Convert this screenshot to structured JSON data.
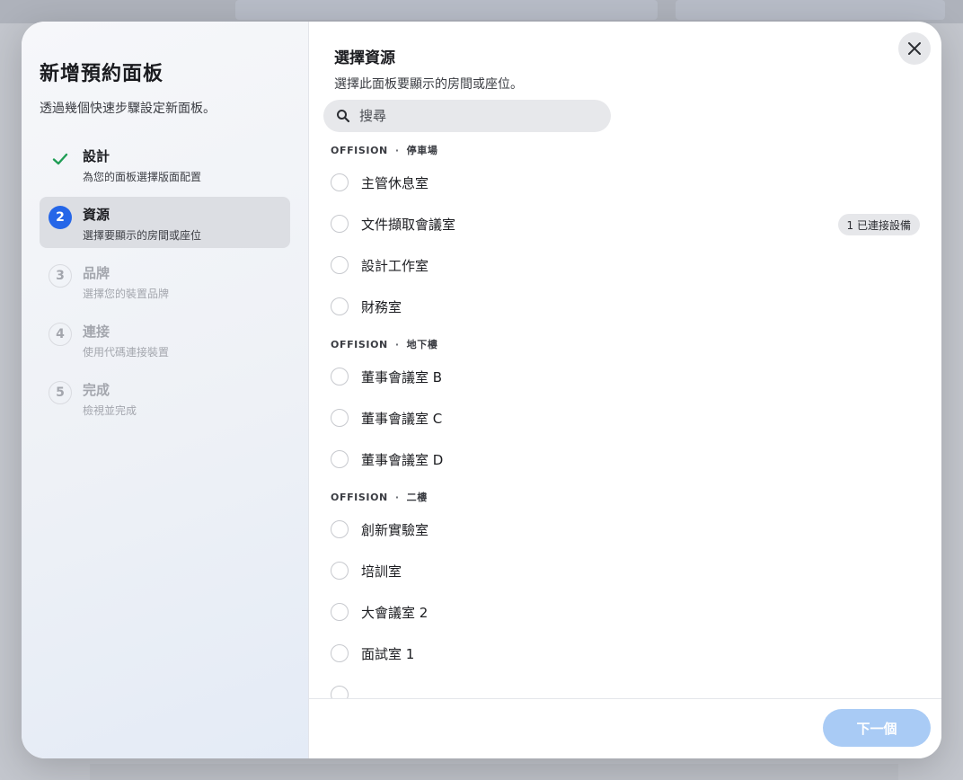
{
  "wizard": {
    "title": "新增預約面板",
    "subtitle": "透過幾個快速步驟設定新面板。",
    "steps": [
      {
        "number": "✓",
        "title": "設計",
        "desc": "為您的面板選擇版面配置",
        "state": "done"
      },
      {
        "number": "2",
        "title": "資源",
        "desc": "選擇要顯示的房間或座位",
        "state": "current"
      },
      {
        "number": "3",
        "title": "品牌",
        "desc": "選擇您的裝置品牌",
        "state": "todo"
      },
      {
        "number": "4",
        "title": "連接",
        "desc": "使用代碼連接裝置",
        "state": "todo"
      },
      {
        "number": "5",
        "title": "完成",
        "desc": "檢視並完成",
        "state": "todo"
      }
    ]
  },
  "resources": {
    "title": "選擇資源",
    "subtitle": "選擇此面板要顯示的房間或座位。",
    "search_placeholder": "搜尋",
    "groups": [
      {
        "building": "OFFISION",
        "floor": "停車場",
        "items": [
          {
            "label": "主管休息室",
            "badge": ""
          },
          {
            "label": "文件擷取會議室",
            "badge": "1 已連接設備"
          },
          {
            "label": "設計工作室",
            "badge": ""
          },
          {
            "label": "財務室",
            "badge": ""
          }
        ]
      },
      {
        "building": "OFFISION",
        "floor": "地下樓",
        "items": [
          {
            "label": "董事會議室 B",
            "badge": ""
          },
          {
            "label": "董事會議室 C",
            "badge": ""
          },
          {
            "label": "董事會議室 D",
            "badge": ""
          }
        ]
      },
      {
        "building": "OFFISION",
        "floor": "二樓",
        "items": [
          {
            "label": "創新實驗室",
            "badge": ""
          },
          {
            "label": "培訓室",
            "badge": ""
          },
          {
            "label": "大會議室 2",
            "badge": ""
          },
          {
            "label": "面試室 1",
            "badge": ""
          },
          {
            "label": "",
            "badge": ""
          }
        ]
      }
    ]
  },
  "footer": {
    "next_label": "下一個"
  },
  "colors": {
    "accent": "#2566e8",
    "done": "#1f9d55",
    "next_disabled": "#a9cbf5"
  },
  "icons": {
    "close": "close-icon",
    "search": "search-icon",
    "check": "check-icon"
  }
}
